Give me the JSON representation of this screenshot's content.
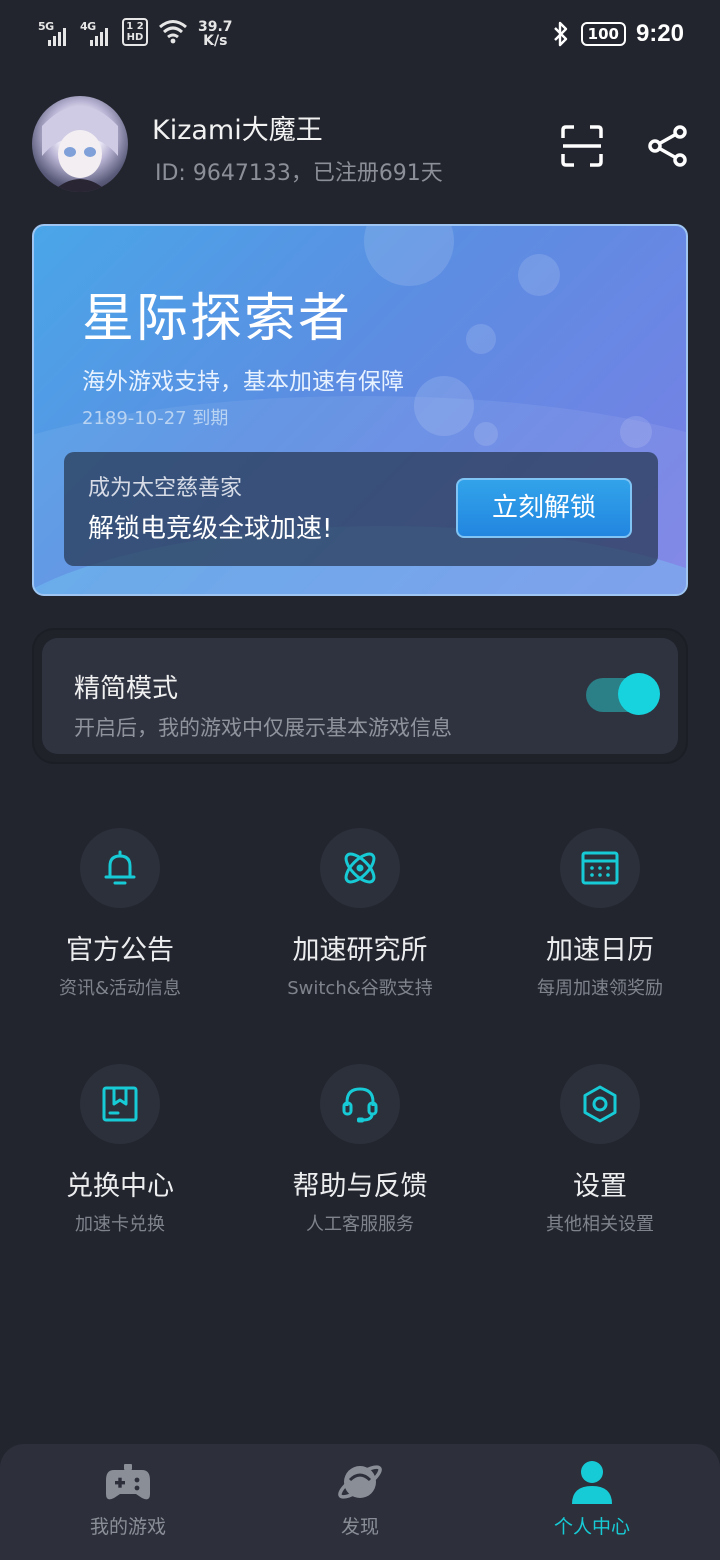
{
  "status_bar": {
    "sim1": "5G",
    "sim2": "4G",
    "hd": "1 2\nHD",
    "speed_value": "39.7",
    "speed_unit": "K/s",
    "battery": "100",
    "time": "9:20"
  },
  "profile": {
    "username": "Kizami大魔王",
    "id_line": "ID: 9647133，已注册691天"
  },
  "vip_card": {
    "title": "星际探索者",
    "subtitle": "海外游戏支持，基本加速有保障",
    "expiry": "2189-10-27 到期",
    "promo_line1": "成为太空慈善家",
    "promo_line2": "解锁电竞级全球加速!",
    "unlock_button": "立刻解锁"
  },
  "simple_mode": {
    "title": "精简模式",
    "description": "开启后，我的游戏中仅展示基本游戏信息",
    "enabled": true
  },
  "menu": [
    {
      "label": "官方公告",
      "sub": "资讯&活动信息",
      "icon": "bell-icon"
    },
    {
      "label": "加速研究所",
      "sub": "Switch&谷歌支持",
      "icon": "atom-icon"
    },
    {
      "label": "加速日历",
      "sub": "每周加速领奖励",
      "icon": "calendar-icon"
    },
    {
      "label": "兑换中心",
      "sub": "加速卡兑换",
      "icon": "gift-box-icon"
    },
    {
      "label": "帮助与反馈",
      "sub": "人工客服服务",
      "icon": "headset-icon"
    },
    {
      "label": "设置",
      "sub": "其他相关设置",
      "icon": "settings-hexagon-icon"
    }
  ],
  "bottom_nav": [
    {
      "label": "我的游戏",
      "icon": "gamepad-icon",
      "active": false
    },
    {
      "label": "发现",
      "icon": "planet-icon",
      "active": false
    },
    {
      "label": "个人中心",
      "icon": "person-icon",
      "active": true
    }
  ],
  "colors": {
    "background": "#22252e",
    "accent": "#17cbd6",
    "card_blue": "#4aa6e8",
    "card_purple": "#7b7fe6"
  }
}
